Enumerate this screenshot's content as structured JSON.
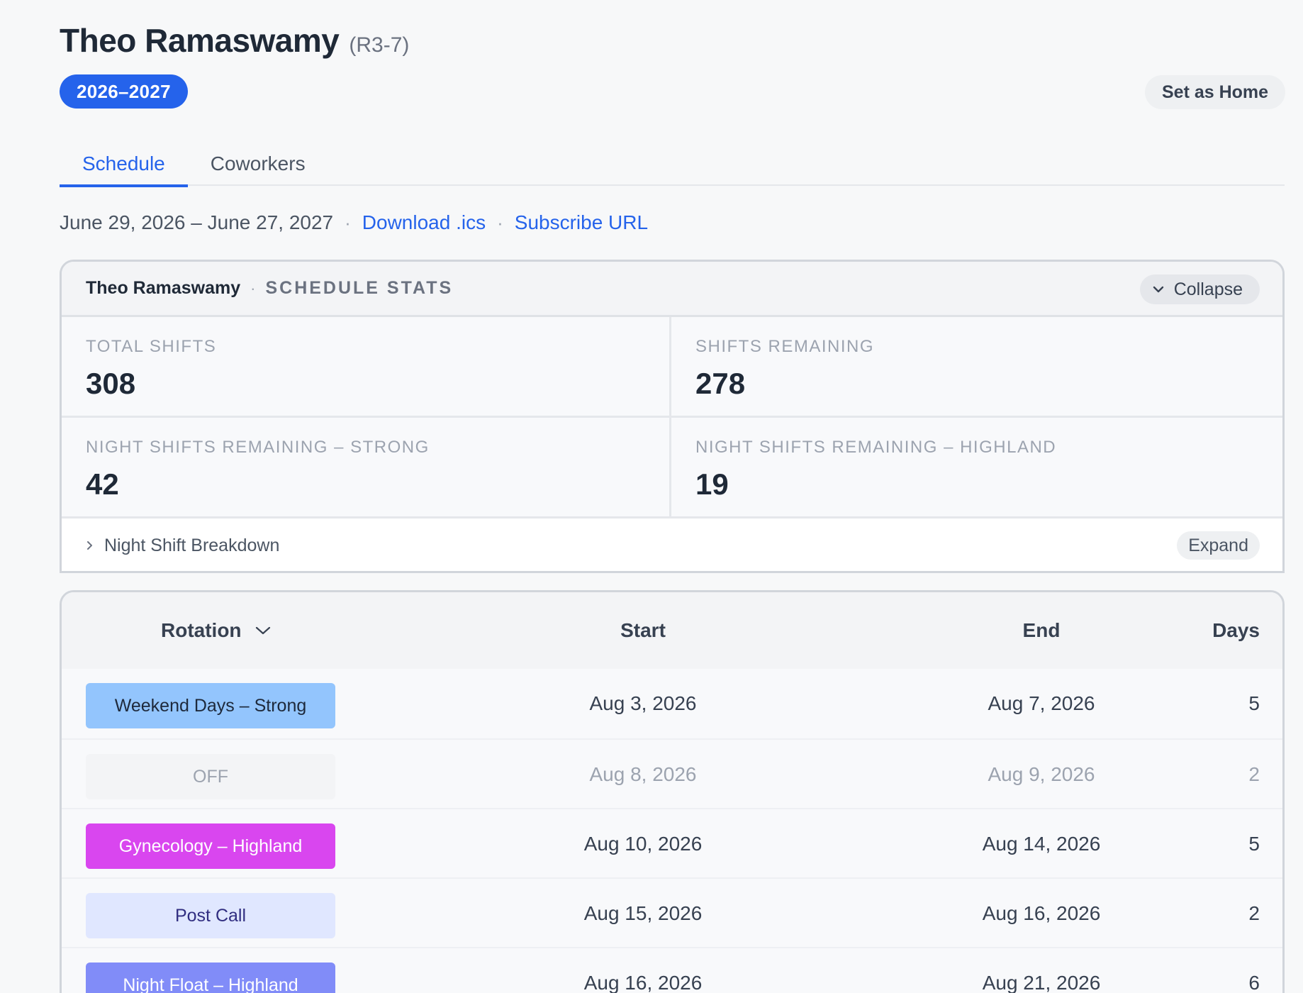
{
  "header": {
    "name": "Theo Ramaswamy",
    "code": "(R3-7)",
    "year": "2026–2027",
    "set_home_label": "Set as Home"
  },
  "tabs": [
    {
      "label": "Schedule",
      "active": true
    },
    {
      "label": "Coworkers",
      "active": false
    }
  ],
  "date_line": {
    "range": "June 29, 2026 – June 27, 2027",
    "separator": "·",
    "download_label": "Download .ics",
    "subscribe_label": "Subscribe URL"
  },
  "stats": {
    "owner": "Theo Ramaswamy",
    "separator": "·",
    "title": "SCHEDULE STATS",
    "collapse_label": "Collapse",
    "cells": [
      {
        "label": "TOTAL SHIFTS",
        "value": "308"
      },
      {
        "label": "SHIFTS REMAINING",
        "value": "278"
      },
      {
        "label": "NIGHT SHIFTS REMAINING – STRONG",
        "value": "42"
      },
      {
        "label": "NIGHT SHIFTS REMAINING – HIGHLAND",
        "value": "19"
      }
    ],
    "breakdown_label": "Night Shift Breakdown",
    "expand_label": "Expand"
  },
  "table": {
    "headers": {
      "rotation": "Rotation",
      "start": "Start",
      "end": "End",
      "days": "Days"
    },
    "rows": [
      {
        "rotation": "Weekend Days – Strong",
        "start": "Aug 3, 2026",
        "end": "Aug 7, 2026",
        "days": "5",
        "bg": "#93c5fd",
        "fg": "#1e293b"
      },
      {
        "rotation": "OFF",
        "start": "Aug 8, 2026",
        "end": "Aug 9, 2026",
        "days": "2",
        "bg": "#f3f4f6",
        "fg": "#9ca3af",
        "muted": true
      },
      {
        "rotation": "Gynecology – Highland",
        "start": "Aug 10, 2026",
        "end": "Aug 14, 2026",
        "days": "5",
        "bg": "#d946ef",
        "fg": "#ffffff"
      },
      {
        "rotation": "Post Call",
        "start": "Aug 15, 2026",
        "end": "Aug 16, 2026",
        "days": "2",
        "bg": "#e0e7ff",
        "fg": "#312e81"
      },
      {
        "rotation": "Night Float – Highland",
        "start": "Aug 16, 2026",
        "end": "Aug 21, 2026",
        "days": "6",
        "bg": "#818cf8",
        "fg": "#ffffff"
      }
    ]
  }
}
